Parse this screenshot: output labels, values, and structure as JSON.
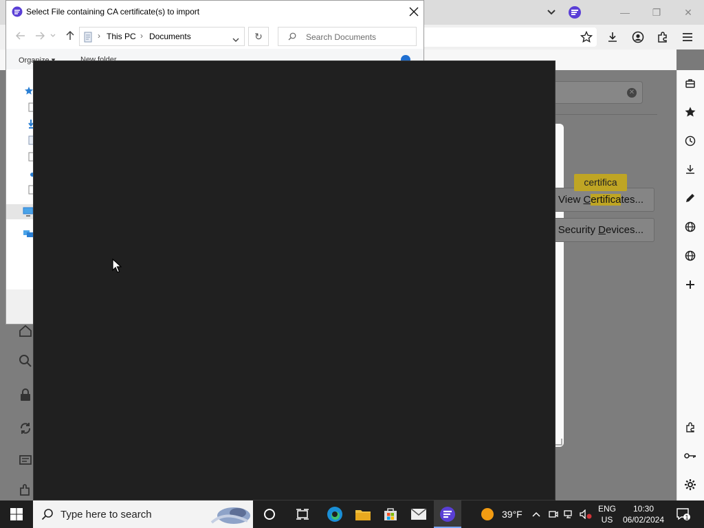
{
  "browser": {
    "window_controls": {
      "minimize": "—",
      "restore": "❐",
      "close": "✕"
    }
  },
  "content": {
    "tooltip": "certifica",
    "view_certs": {
      "pre": "View ",
      "accel": "C",
      "hl": "ertifica",
      "post": "tes..."
    },
    "security_devices": {
      "pre": "Security ",
      "accel": "D",
      "post": "evices..."
    }
  },
  "dialog": {
    "title": "Select File containing CA certificate(s) to import",
    "breadcrumb": [
      "This PC",
      "Documents"
    ],
    "search_placeholder": "Search Documents",
    "organize": "Organize ▾",
    "new_folder": "New folder"
  },
  "taskbar": {
    "search_placeholder": "Type here to search",
    "weather": "39°F",
    "lang": {
      "line1": "ENG",
      "line2": "US"
    },
    "clock": {
      "time": "10:30",
      "date": "06/02/2024"
    },
    "notification_count": "1"
  },
  "colors": {
    "highlight": "#bfa524",
    "browser_accent": "#5a3fd6",
    "taskbar": "#1f1f1f",
    "overlay": "#202020"
  }
}
